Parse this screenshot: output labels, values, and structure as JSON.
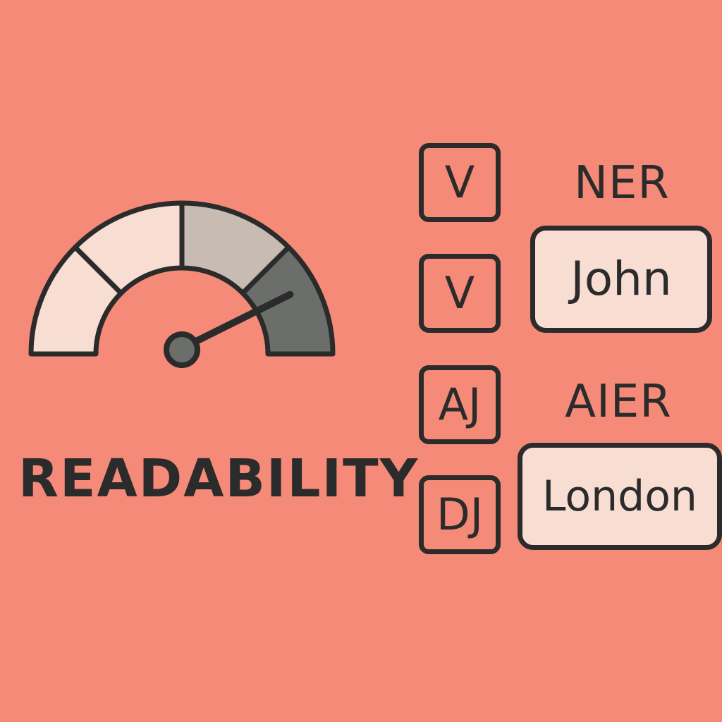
{
  "gauge": {
    "caption": "READABILITY",
    "segments": 4,
    "needle_fraction": 0.84,
    "colors": {
      "outline": "#2b2b2b",
      "seg1": "#f8ddd2",
      "seg2": "#f8ddd2",
      "seg3": "#c7bbb2",
      "seg4": "#6b6e6a",
      "hub": "#6b6e6a"
    }
  },
  "labels": [
    {
      "box": "V",
      "heading": "NER",
      "entity": "John"
    },
    {
      "box": "V"
    },
    {
      "box": "AJ",
      "heading": "AIER",
      "entity": "London"
    },
    {
      "box": "DJ"
    }
  ],
  "colors": {
    "background": "#f58a78",
    "ink": "#2b2b2b",
    "entity_fill": "#f8ddd2"
  }
}
